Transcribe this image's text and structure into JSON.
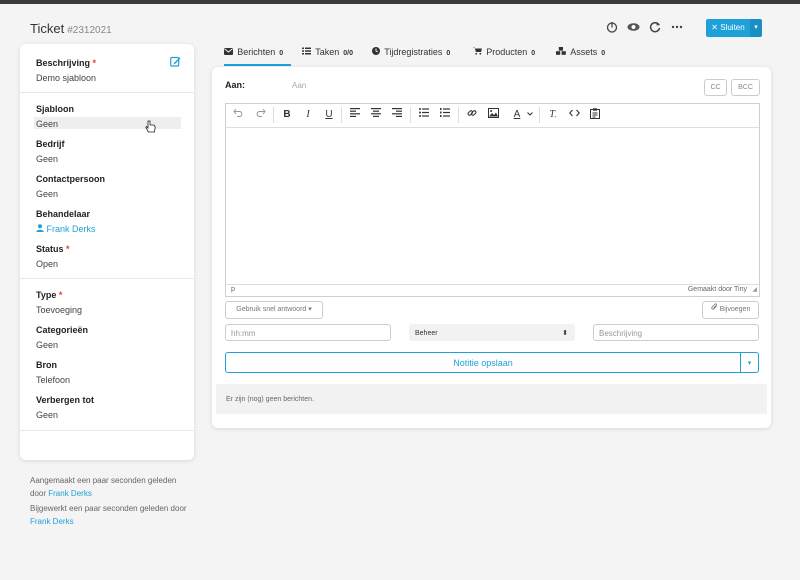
{
  "header": {
    "title": "Ticket",
    "ticket_number": "#2312021",
    "close_label": "✕ Sluiten",
    "icons": [
      "history-icon",
      "eye-icon",
      "refresh-icon",
      "more-icon"
    ]
  },
  "sidebar": {
    "fields": [
      {
        "label": "Beschrijving",
        "required": "*",
        "value": "Demo sjabloon"
      },
      {
        "label": "Sjabloon",
        "value": "Geen"
      },
      {
        "label": "Bedrijf",
        "value": "Geen"
      },
      {
        "label": "Contactpersoon",
        "value": "Geen"
      },
      {
        "label": "Behandelaar",
        "value": "Frank Derks"
      },
      {
        "label": "Status",
        "required": "*",
        "value": "Open"
      },
      {
        "label": "Type",
        "required": "*",
        "value": "Toevoeging"
      },
      {
        "label": "Categorieën",
        "value": "Geen"
      },
      {
        "label": "Bron",
        "value": "Telefoon"
      },
      {
        "label": "Verbergen tot",
        "value": "Geen"
      }
    ]
  },
  "meta": {
    "created_text": "Aangemaakt een paar seconden geleden door",
    "created_by": "Frank Derks",
    "updated_text": "Bijgewerkt een paar seconden geleden door",
    "updated_by": "Frank Derks"
  },
  "tabs": [
    {
      "label": "Berichten",
      "count": "0"
    },
    {
      "label": "Taken",
      "count": "0/0"
    },
    {
      "label": "Tijdregistraties",
      "count": "0"
    },
    {
      "label": "Producten",
      "count": "0"
    },
    {
      "label": "Assets",
      "count": "0"
    }
  ],
  "compose": {
    "to_label": "Aan:",
    "to_placeholder": "Aan",
    "cc_label": "CC",
    "bcc_label": "BCC",
    "status_path": "p",
    "made_by": "Gemaakt door Tiny",
    "quick_reply": "Gebruik snel antwoord ▾",
    "attach": "Bijvoegen",
    "time_placeholder": "hh:mm",
    "select_value": "Beheer",
    "description_placeholder": "Beschrijving",
    "save_label": "Notitie opslaan",
    "no_messages": "Er zijn (nog) geen berichten."
  },
  "colors": {
    "accent": "#1fa0d9",
    "required": "#e53935"
  }
}
